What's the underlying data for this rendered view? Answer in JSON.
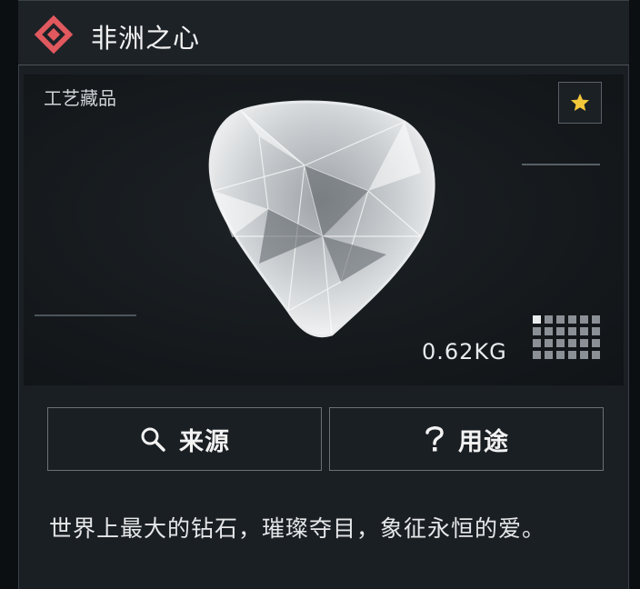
{
  "header": {
    "title": "非洲之心",
    "icon": "diamond-badge-icon",
    "accent": "#e0595e"
  },
  "item": {
    "category": "工艺藏品",
    "weight": "0.62KG",
    "favorite_icon": "star-icon",
    "favorite_color": "#f3c73a"
  },
  "actions": {
    "source_label": "来源",
    "source_icon": "search-icon",
    "usage_label": "用途",
    "usage_icon": "question-icon"
  },
  "description": "世界上最大的钻石，璀璨夺目，象征永恒的爱。"
}
